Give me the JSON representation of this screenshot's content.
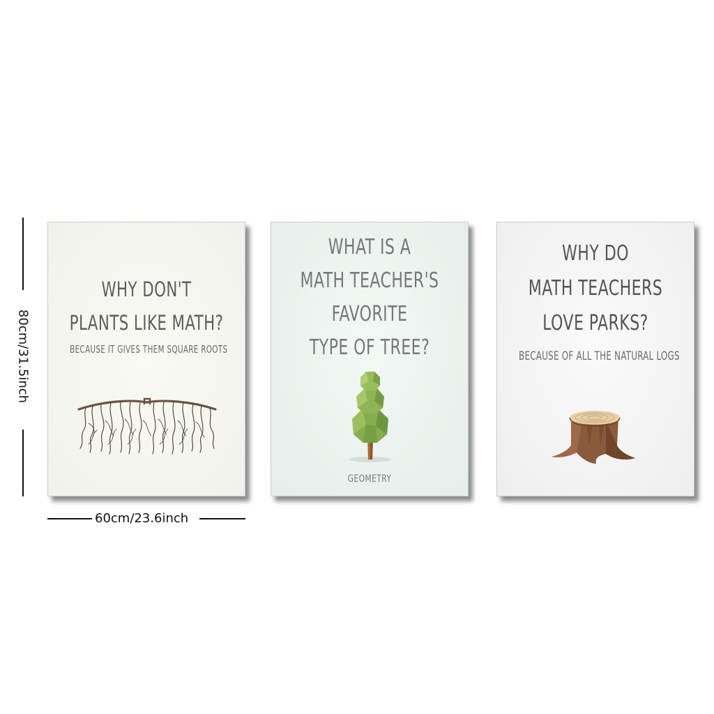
{
  "dimensions": {
    "height_label": "80cm/31.5inch",
    "width_label": "60cm/23.6inch"
  },
  "posters": [
    {
      "title": "WHY DON'T\nPLANTS LIKE MATH?",
      "subtitle": "BECAUSE IT GIVES THEM SQUARE ROOTS",
      "art": "square-roots-illustration",
      "background": "#f3f3ee"
    },
    {
      "title": "WHAT IS A\nMATH TEACHER'S\nFAVORITE\nTYPE OF TREE?",
      "caption": "GEOMETRY",
      "art": "geometric-topiary-tree-illustration",
      "background": "#e8f0ec"
    },
    {
      "title": "WHY DO\nMATH TEACHERS\nLOVE PARKS?",
      "subtitle": "BECAUSE OF ALL THE NATURAL LOGS",
      "art": "tree-stump-illustration",
      "background": "#f2f2f2"
    }
  ],
  "colors": {
    "text": "#5d5d5d",
    "bark": "#8a5a3c",
    "leaf": "#7fa64a"
  }
}
